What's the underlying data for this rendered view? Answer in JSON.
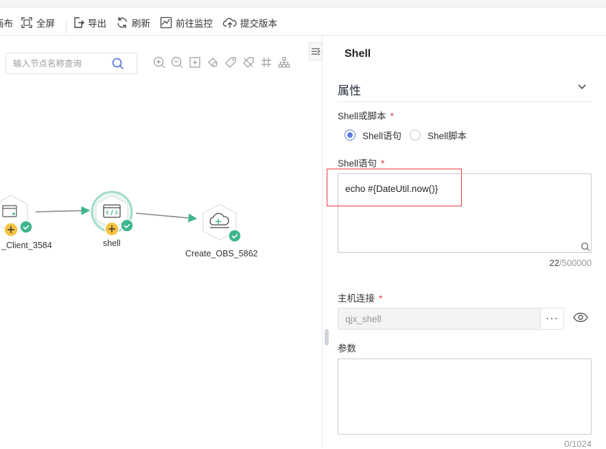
{
  "toolbar": {
    "items": [
      {
        "label": "画布",
        "icon": "canvas-icon"
      },
      {
        "label": "全屏",
        "icon": "fullscreen-icon"
      },
      {
        "label": "导出",
        "icon": "export-icon"
      },
      {
        "label": "刷新",
        "icon": "refresh-icon"
      },
      {
        "label": "前往监控",
        "icon": "monitor-icon"
      },
      {
        "label": "提交版本",
        "icon": "upload-cloud-icon"
      }
    ]
  },
  "canvas": {
    "search_placeholder": "输入节点名称查询",
    "nodes": [
      {
        "label": "_Client_3584",
        "status": "success"
      },
      {
        "label": "shell",
        "status": "success",
        "selected": true
      },
      {
        "label": "Create_OBS_5862",
        "status": "success"
      }
    ],
    "colors": {
      "accent": "#3fb58f",
      "warning": "#f5c242",
      "edge": "#888888"
    }
  },
  "panel": {
    "title": "Shell",
    "section_title": "属性",
    "shell_or_script_label": "Shell或脚本",
    "radio_options": [
      "Shell语句",
      "Shell脚本"
    ],
    "radio_selected": "Shell语句",
    "statement_label": "Shell语句",
    "statement_value": "echo #{DateUtil.now()}",
    "statement_count": "22",
    "statement_max": "/500000",
    "host_label": "主机连接",
    "host_value": "qjx_shell",
    "host_more": "···",
    "params_label": "参数",
    "params_value": "",
    "params_counter": "0/1024",
    "required_mark": "*"
  },
  "colors": {
    "primary": "#5e7ce0",
    "required": "#e5393b",
    "highlight": "#e53a3a"
  }
}
